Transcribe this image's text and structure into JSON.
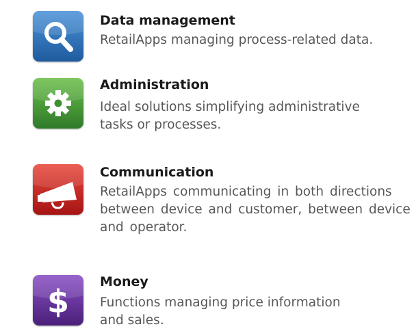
{
  "categories": [
    {
      "title": "Data management",
      "description_lines": [
        "RetailApps managing process-related data."
      ],
      "icon": "magnifier-icon",
      "color": "#2f6fb3"
    },
    {
      "title": "Administration",
      "description_lines": [
        "Ideal solutions simplifying administrative",
        "tasks or processes."
      ],
      "icon": "gear-icon",
      "color": "#3d8f32"
    },
    {
      "title": "Communication",
      "description_lines": [
        "RetailApps communicating in both directions",
        "between device and customer, between device",
        "and operator."
      ],
      "icon": "megaphone-icon",
      "color": "#c8201e"
    },
    {
      "title": "Money",
      "description_lines": [
        "Functions managing price information",
        "and sales."
      ],
      "icon": "dollar-icon",
      "color": "#5b2b8f"
    }
  ]
}
